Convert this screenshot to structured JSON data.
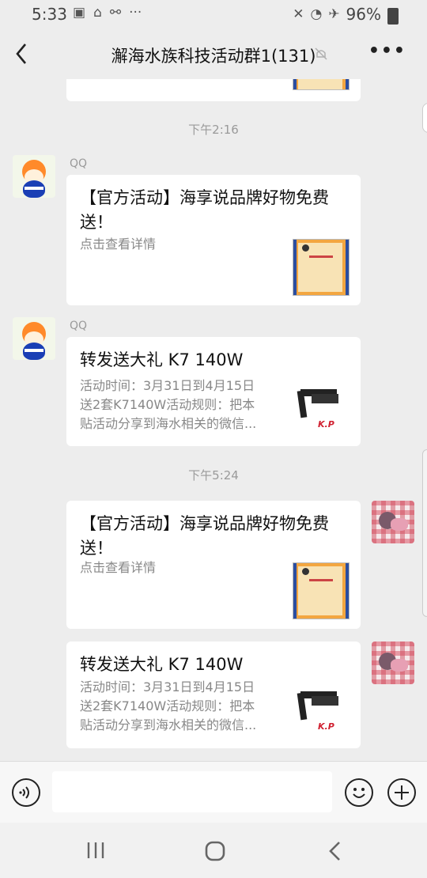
{
  "status_bar": {
    "time": "5:33",
    "battery": "96%"
  },
  "header": {
    "title": "澥海水族科技活动群1(131)"
  },
  "chat": {
    "timestamps": [
      "下午2:16",
      "下午5:24"
    ],
    "messages": [
      {
        "sender": "QQ",
        "title": "【官方活动】海享说品牌好物免费送！",
        "desc": "点击查看详情"
      },
      {
        "sender": "QQ",
        "title": "转发送大礼 K7 140W",
        "desc_lines": [
          "活动时间：3月31日到4月15日",
          "送2套K7140W活动规则：把本",
          "贴活动分享到海水相关的微信..."
        ]
      },
      {
        "title": "【官方活动】海享说品牌好物免费送！",
        "desc": "点击查看详情"
      },
      {
        "title": "转发送大礼 K7 140W",
        "desc_lines": [
          "活动时间：3月31日到4月15日",
          "送2套K7140W活动规则：把本",
          "贴活动分享到海水相关的微信..."
        ]
      }
    ]
  },
  "icons": [
    "back-arrow",
    "mute-bell",
    "more-dots",
    "voice",
    "emoji",
    "plus",
    "recent-apps",
    "home",
    "back"
  ]
}
